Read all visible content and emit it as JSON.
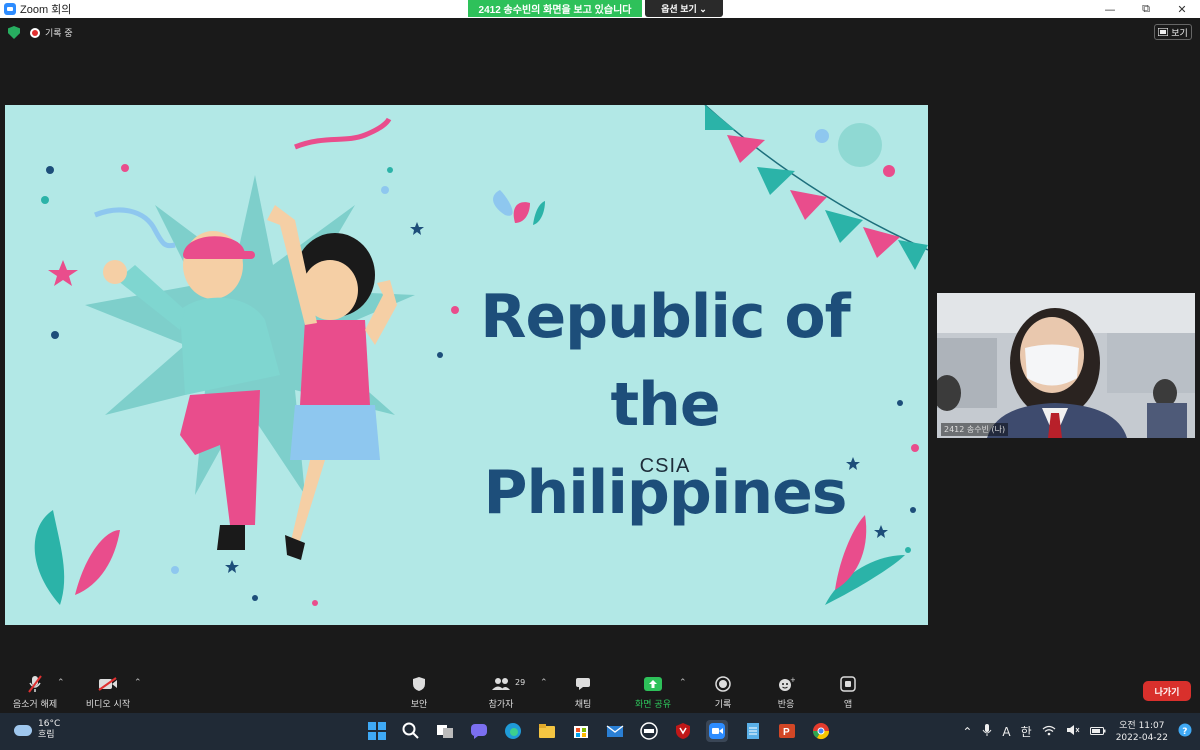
{
  "window": {
    "title": "Zoom 회의",
    "minimize": "—",
    "restore": "⧉",
    "close": "✕"
  },
  "share_banner": {
    "text": "2412 송수빈의 화면을 보고 있습니다",
    "options_label": "옵션 보기 ⌄"
  },
  "status": {
    "recording_label": "기록 중",
    "view_label": "보기"
  },
  "slide": {
    "title_line1": "Republic of",
    "title_line2": "the Philippines",
    "subtitle": "CSIA"
  },
  "self_video": {
    "name": "2412 송수빈 (나)"
  },
  "toolbar": {
    "mute": "음소거 해제",
    "video": "비디오 시작",
    "security": "보안",
    "participants": "참가자",
    "participants_count": "29",
    "chat": "채팅",
    "share_screen": "화면 공유",
    "record": "기록",
    "reactions": "반응",
    "apps": "앱",
    "leave": "나가기"
  },
  "taskbar": {
    "weather_temp": "16°C",
    "weather_desc": "흐림",
    "ime_a": "A",
    "ime_han": "한",
    "time": "오전 11:07",
    "date": "2022-04-22"
  }
}
